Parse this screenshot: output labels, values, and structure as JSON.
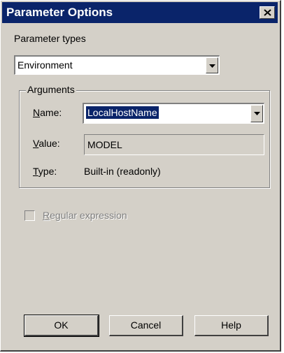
{
  "dialog": {
    "title": "Parameter Options"
  },
  "parameter_types": {
    "label": "Parameter types",
    "selected": "Environment"
  },
  "arguments": {
    "group_title": "Arguments",
    "name_label": "Name:",
    "name_value": "LocalHostName",
    "value_label": "Value:",
    "value_value": "MODEL",
    "type_label": "Type:",
    "type_value": "Built-in (readonly)"
  },
  "regex": {
    "label": "Regular expression",
    "checked": false,
    "enabled": false
  },
  "buttons": {
    "ok": "OK",
    "cancel": "Cancel",
    "help": "Help"
  }
}
